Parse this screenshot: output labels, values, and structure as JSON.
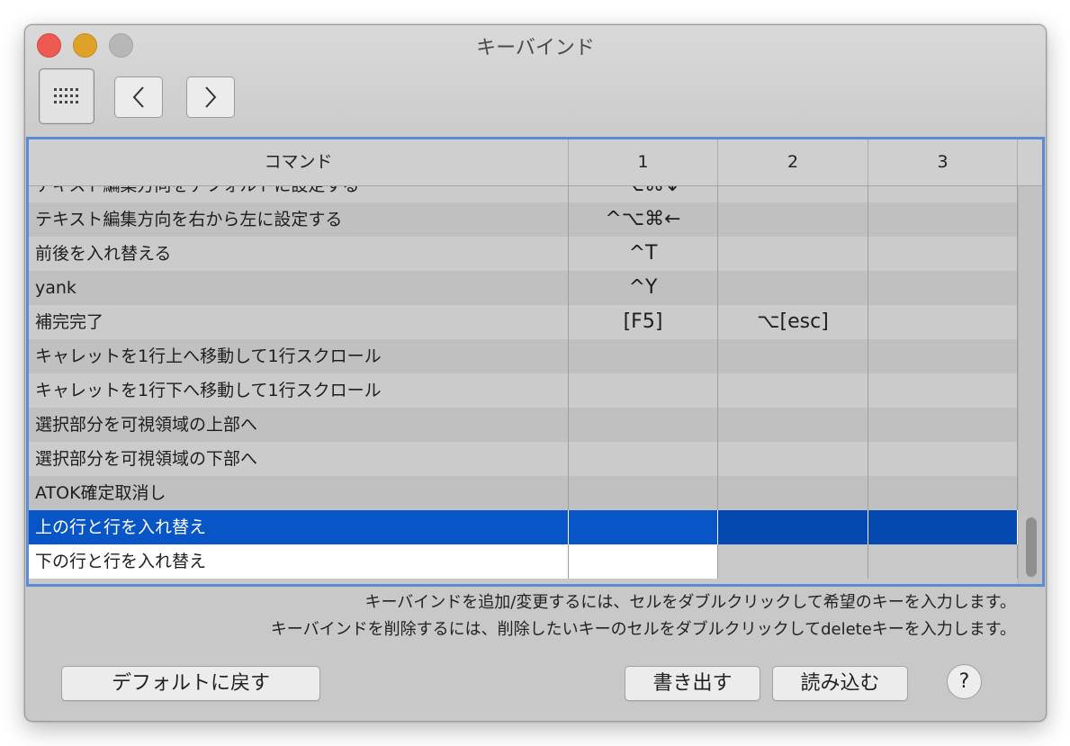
{
  "window": {
    "title": "キーバインド"
  },
  "toolbar": {
    "grid_icon": "grid-icon",
    "back_icon": "chevron-left-icon",
    "forward_icon": "chevron-right-icon"
  },
  "table": {
    "columns": [
      "コマンド",
      "1",
      "2",
      "3"
    ],
    "rows": [
      {
        "command": "テキスト編集方向をデフォルトに設定する",
        "k1": "^⌥⌘↓",
        "k2": "",
        "k3": ""
      },
      {
        "command": "テキスト編集方向を右から左に設定する",
        "k1": "^⌥⌘←",
        "k2": "",
        "k3": ""
      },
      {
        "command": "前後を入れ替える",
        "k1": "^T",
        "k2": "",
        "k3": ""
      },
      {
        "command": "yank",
        "k1": "^Y",
        "k2": "",
        "k3": ""
      },
      {
        "command": "補完完了",
        "k1": "[F5]",
        "k2": "⌥[esc]",
        "k3": ""
      },
      {
        "command": "キャレットを1行上へ移動して1行スクロール",
        "k1": "",
        "k2": "",
        "k3": ""
      },
      {
        "command": "キャレットを1行下へ移動して1行スクロール",
        "k1": "",
        "k2": "",
        "k3": ""
      },
      {
        "command": "選択部分を可視領域の上部へ",
        "k1": "",
        "k2": "",
        "k3": ""
      },
      {
        "command": "選択部分を可視領域の下部へ",
        "k1": "",
        "k2": "",
        "k3": ""
      },
      {
        "command": "ATOK確定取消し",
        "k1": "",
        "k2": "",
        "k3": ""
      },
      {
        "command": "上の行と行を入れ替え",
        "k1": "",
        "k2": "",
        "k3": "",
        "selected": true
      },
      {
        "command": "下の行と行を入れ替え",
        "k1": "",
        "k2": "",
        "k3": ""
      }
    ]
  },
  "info": {
    "line1": "キーバインドを追加/変更するには、セルをダブルクリックして希望のキーを入力します。",
    "line2": "キーバインドを削除するには、削除したいキーのセルをダブルクリックしてdeleteキーを入力します。"
  },
  "buttons": {
    "default": "デフォルトに戻す",
    "export": "書き出す",
    "import": "読み込む",
    "help": "?"
  },
  "colors": {
    "selection": "#0755c6",
    "focus_ring": "#5b8bd5"
  }
}
